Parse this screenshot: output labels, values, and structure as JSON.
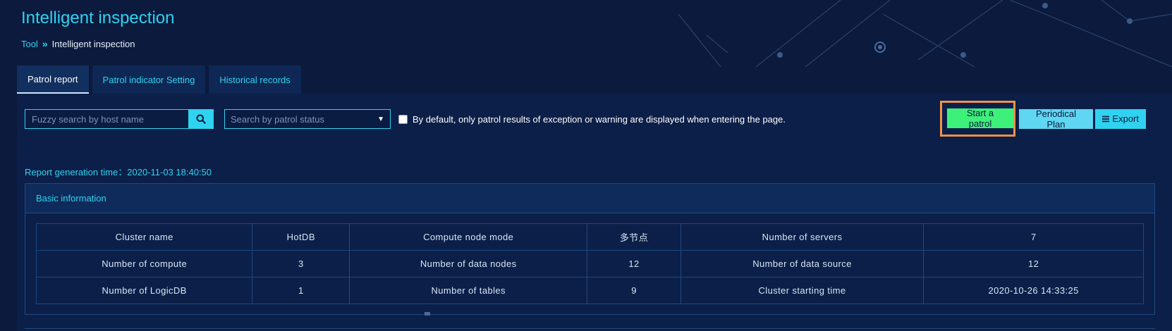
{
  "page": {
    "title": "Intelligent inspection",
    "breadcrumb": {
      "root": "Tool",
      "separator": "»",
      "current": "Intelligent inspection"
    }
  },
  "tabs": [
    {
      "label": "Patrol report",
      "active": true
    },
    {
      "label": "Patrol indicator Setting",
      "active": false
    },
    {
      "label": "Historical records",
      "active": false
    }
  ],
  "toolbar": {
    "search_placeholder": "Fuzzy search by host name",
    "search_icon": "search-icon",
    "status_placeholder": "Search by patrol status",
    "checkbox_label": "By default, only patrol results of exception or warning are displayed when entering the page.",
    "checkbox_checked": false,
    "start_label": "Start a patrol",
    "plan_label": "Periodical Plan",
    "export_label": "Export",
    "export_icon": "list-icon"
  },
  "report": {
    "time_label": "Report generation time：",
    "time_value": "2020-11-03 18:40:50"
  },
  "basic_info": {
    "title": "Basic information",
    "rows": [
      [
        "Cluster name",
        "HotDB",
        "Compute node mode",
        "多节点",
        "Number of servers",
        "7"
      ],
      [
        "Number of compute",
        "3",
        "Number of data nodes",
        "12",
        "Number of data source",
        "12"
      ],
      [
        "Number of LogicDB",
        "1",
        "Number of tables",
        "9",
        "Cluster starting time",
        "2020-10-26 14:33:25"
      ]
    ]
  },
  "colors": {
    "background": "#0b1a3d",
    "accent": "#2fd3f0",
    "start_button": "#3df07a",
    "highlight": "#f0914a"
  }
}
